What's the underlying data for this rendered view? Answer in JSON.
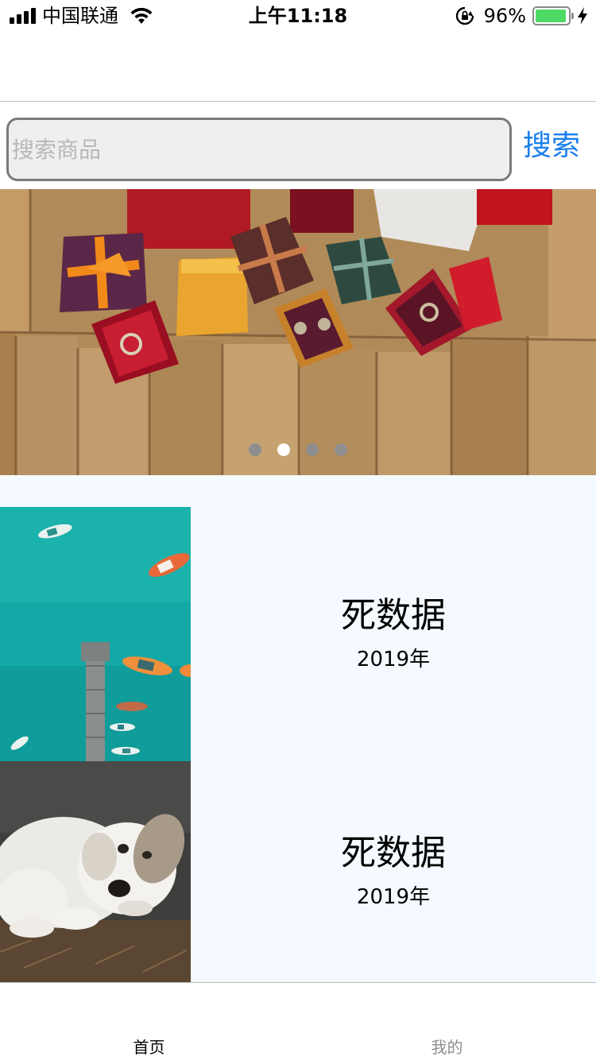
{
  "status_bar": {
    "carrier": "中国联通",
    "time": "上午11:18",
    "battery_percent_label": "96%",
    "battery_level": 0.96
  },
  "search": {
    "placeholder": "搜索商品",
    "value": "",
    "button_label": "搜索"
  },
  "banner": {
    "dot_count": 4,
    "active_index": 1
  },
  "list": [
    {
      "title": "死数据",
      "date": "2019年",
      "image": "aerial-boats-pier"
    },
    {
      "title": "死数据",
      "date": "2019年",
      "image": "white-puppy"
    }
  ],
  "tabs": [
    {
      "label": "首页",
      "active": true
    },
    {
      "label": "我的",
      "active": false
    }
  ],
  "colors": {
    "accent": "#1a7ff0",
    "battery": "#4cd964",
    "list_bg": "#f4faff",
    "inactive_tab": "#8e8e8e"
  }
}
